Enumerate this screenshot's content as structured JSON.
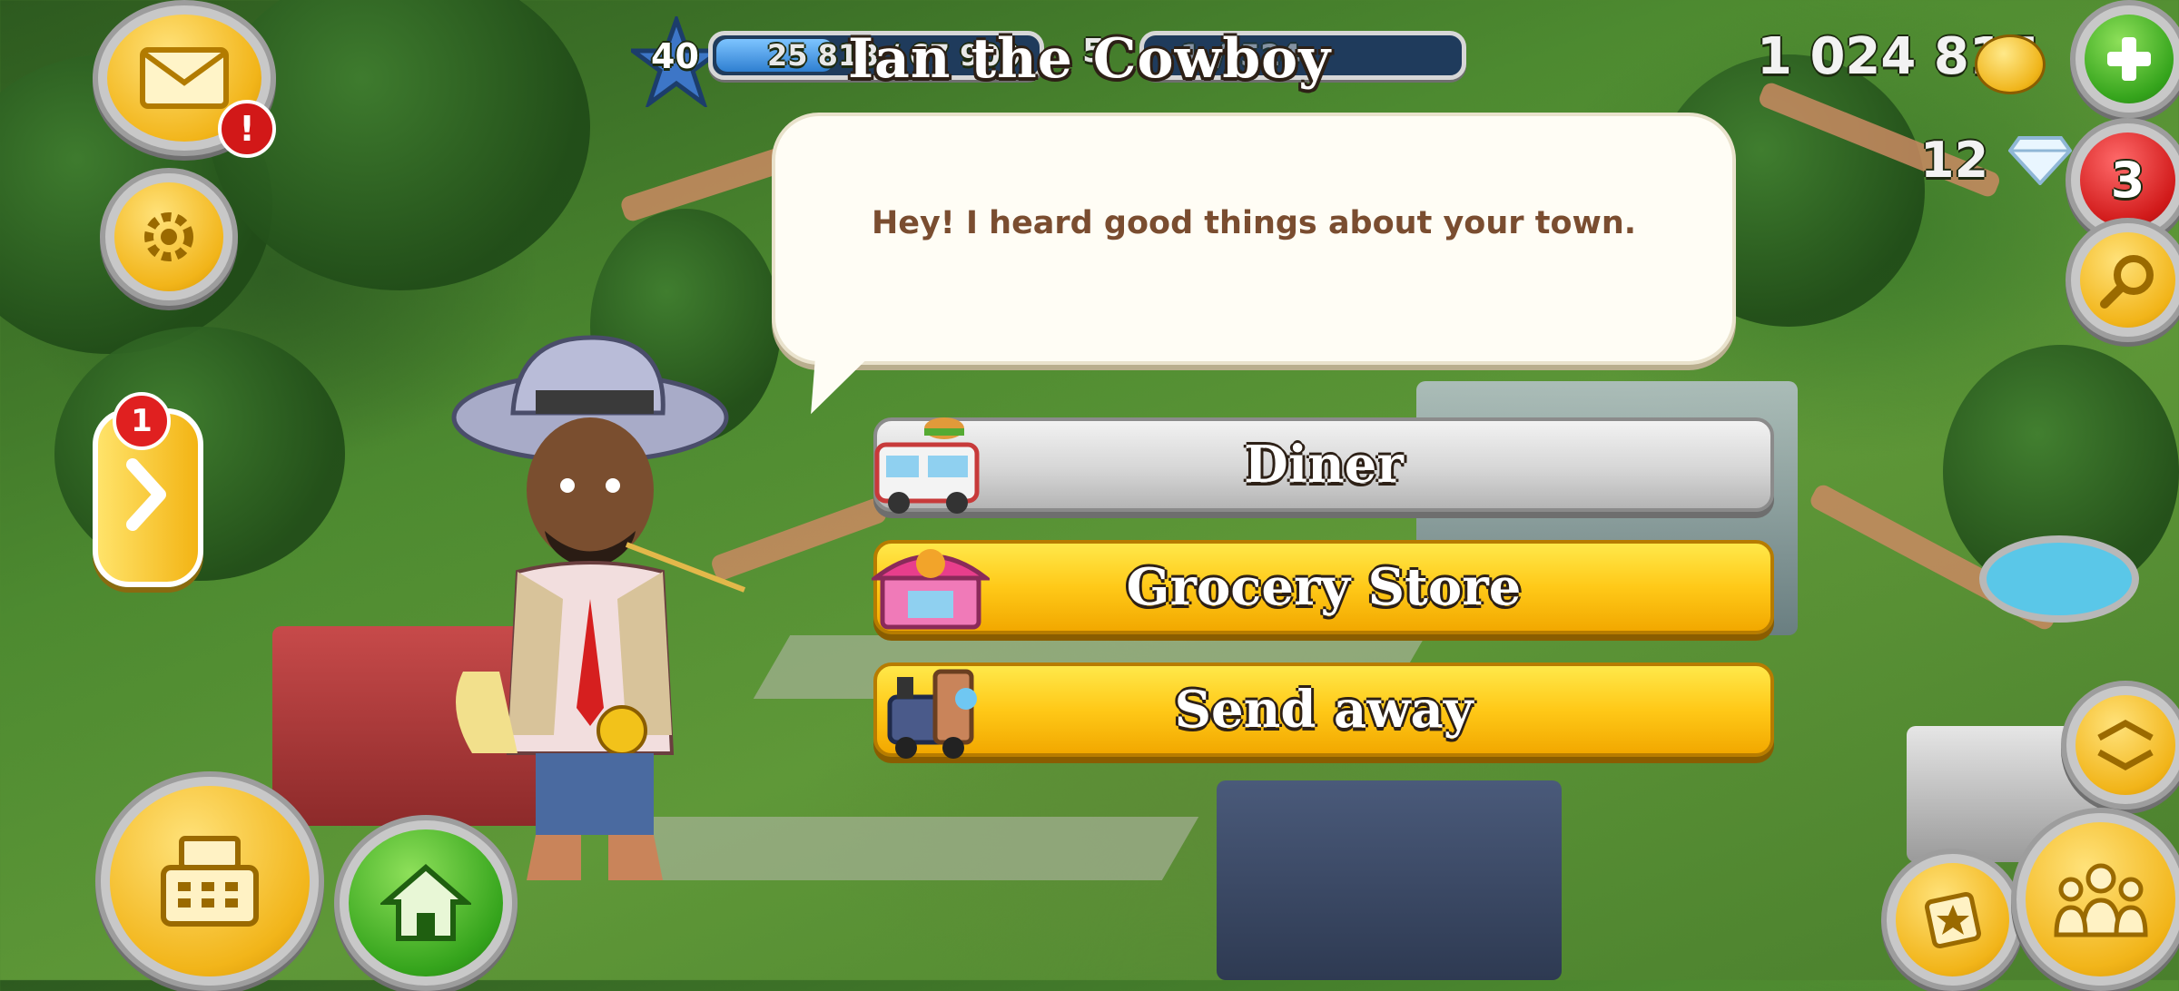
{
  "hud": {
    "level": "40",
    "xp_text": "25 818 / 67 900",
    "xp_progress": 0.38,
    "second_value_prefix": "5",
    "second_bar_text": "1_/_524",
    "coins": "1 024 815",
    "diamonds": "12",
    "mail_badge": "!",
    "side_panel_badge": "1",
    "red_counter": "3"
  },
  "dialog": {
    "speaker": "Ian the Cowboy",
    "message": "Hey! I heard good things about your town.",
    "options": [
      {
        "label": "Diner",
        "style": "gray"
      },
      {
        "label": "Grocery Store",
        "style": "gold"
      },
      {
        "label": "Send away",
        "style": "gold"
      }
    ]
  },
  "icons": {
    "mail": "mail-icon",
    "settings": "gear-icon",
    "add": "plus-icon",
    "search": "magnifier-icon",
    "shop": "cash-register-icon",
    "home": "house-icon",
    "friends": "people-icon"
  },
  "colors": {
    "gold_button": "#ffc918",
    "gray_button": "#d6d6d6",
    "speech_text": "#7a4d30"
  }
}
